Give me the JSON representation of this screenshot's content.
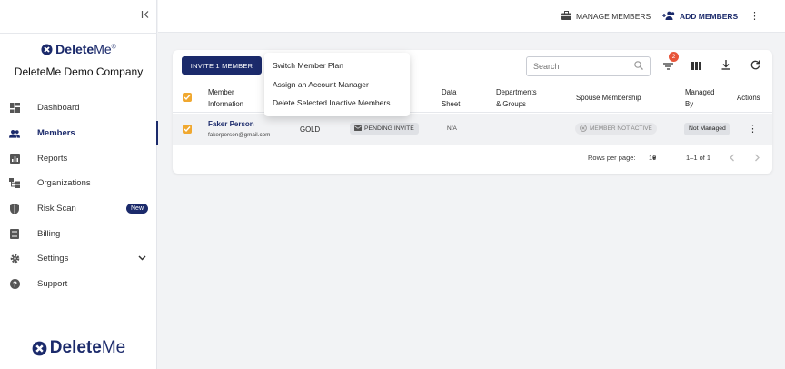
{
  "sidebar": {
    "brand": {
      "bold": "Delete",
      "light": "Me",
      "mark": "®"
    },
    "company": "DeleteMe Demo Company",
    "items": [
      {
        "label": "Dashboard",
        "icon": "dashboard-icon"
      },
      {
        "label": "Members",
        "icon": "members-icon",
        "active": true
      },
      {
        "label": "Reports",
        "icon": "reports-icon"
      },
      {
        "label": "Organizations",
        "icon": "organizations-icon"
      },
      {
        "label": "Risk Scan",
        "icon": "shield-icon",
        "badge": "New"
      },
      {
        "label": "Billing",
        "icon": "billing-icon"
      },
      {
        "label": "Settings",
        "icon": "gear-icon"
      },
      {
        "label": "Support",
        "icon": "help-icon"
      }
    ],
    "footer_brand": {
      "bold": "Delete",
      "light": "Me"
    }
  },
  "topbar": {
    "manage_members": "MANAGE MEMBERS",
    "add_members": "ADD MEMBERS"
  },
  "toolbar": {
    "invite_label": "INVITE 1 MEMBER",
    "search_placeholder": "Search",
    "filter_count": "2"
  },
  "table": {
    "headers": {
      "member_information": [
        "Member",
        "Information"
      ],
      "data_sheet": [
        "Data",
        "Sheet"
      ],
      "departments_groups": [
        "Departments",
        "& Groups"
      ],
      "spouse_membership": "Spouse Membership",
      "managed_by": [
        "Managed",
        "By"
      ],
      "actions": "Actions"
    },
    "rows": [
      {
        "name": "Faker Person",
        "email": "fakerperson@gmail.com",
        "plan": "GOLD",
        "status": "PENDING INVITE",
        "data_sheet": "N/A",
        "spouse": "MEMBER NOT ACTIVE",
        "managed_by": "Not Managed"
      }
    ]
  },
  "pagination": {
    "rows_per_page_label": "Rows per page:",
    "rows_per_page": "10",
    "range": "1–1 of 1"
  },
  "menu": {
    "items": [
      "Switch Member Plan",
      "Assign an Account Manager",
      "Delete Selected Inactive Members"
    ]
  },
  "colors": {
    "brand": "#1b2a6b",
    "checkbox": "#f0a830",
    "badge": "#e8553a"
  }
}
